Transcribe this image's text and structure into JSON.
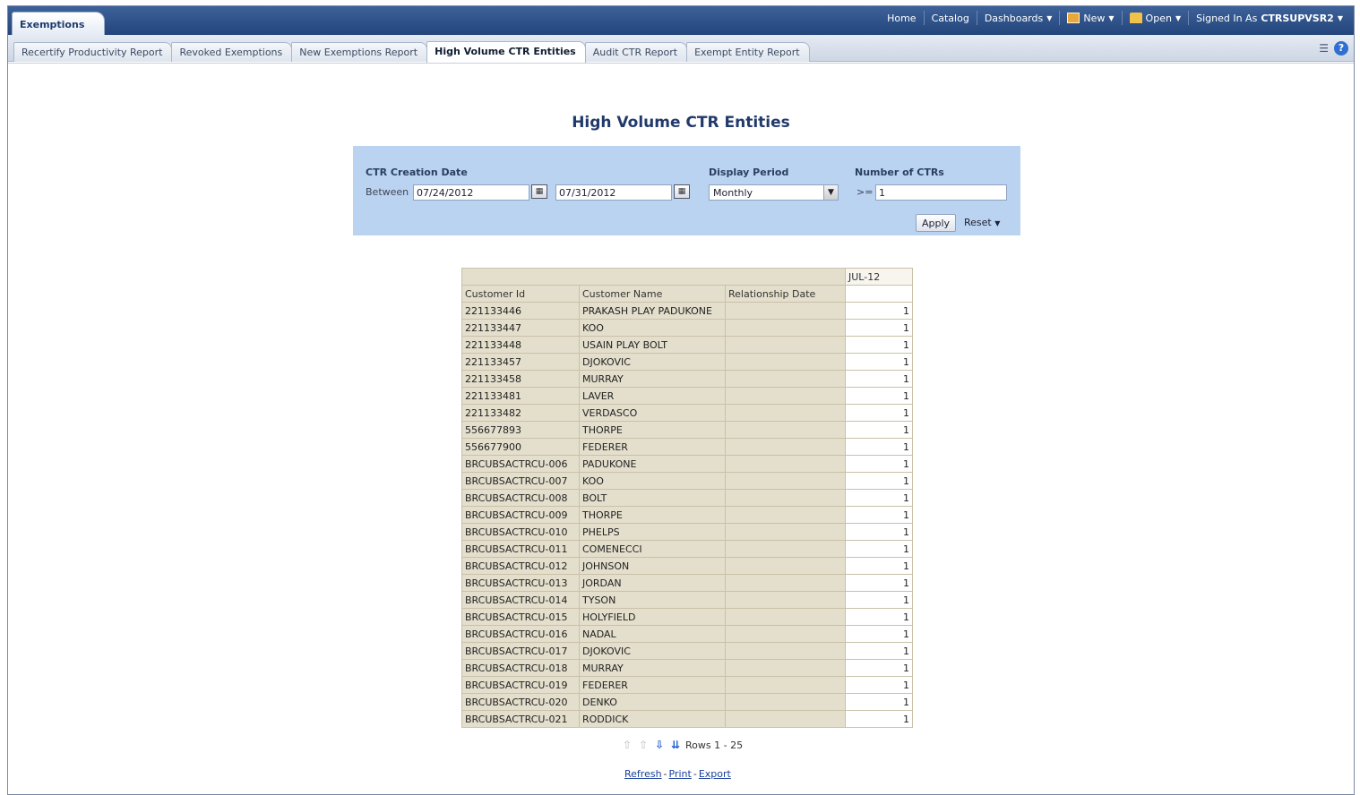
{
  "dashboard_tab": "Exemptions",
  "topnav": {
    "home": "Home",
    "catalog": "Catalog",
    "dashboards": "Dashboards",
    "new": "New",
    "open": "Open",
    "signed_in_as": "Signed In As",
    "user": "CTRSUPVSR2"
  },
  "tabs": [
    "Recertify Productivity Report",
    "Revoked Exemptions",
    "New Exemptions Report",
    "High Volume CTR Entities",
    "Audit CTR Report",
    "Exempt Entity Report"
  ],
  "active_tab_index": 3,
  "page_title": "High Volume CTR Entities",
  "prompts": {
    "ctr_creation_date_label": "CTR Creation Date",
    "between_label": "Between",
    "date_from": "07/24/2012",
    "date_to": "07/31/2012",
    "display_period_label": "Display Period",
    "display_period_value": "Monthly",
    "number_of_ctrs_label": "Number of CTRs",
    "ctr_operator": ">=",
    "ctr_value": "1",
    "apply_label": "Apply",
    "reset_label": "Reset"
  },
  "table": {
    "period_header": "JUL-12",
    "columns": [
      "Customer Id",
      "Customer Name",
      "Relationship Date"
    ],
    "rows": [
      {
        "id": "221133446",
        "name": "PRAKASH PLAY PADUKONE",
        "rel": "",
        "val": "1"
      },
      {
        "id": "221133447",
        "name": "KOO",
        "rel": "",
        "val": "1"
      },
      {
        "id": "221133448",
        "name": "USAIN PLAY BOLT",
        "rel": "",
        "val": "1"
      },
      {
        "id": "221133457",
        "name": "DJOKOVIC",
        "rel": "",
        "val": "1"
      },
      {
        "id": "221133458",
        "name": "MURRAY",
        "rel": "",
        "val": "1"
      },
      {
        "id": "221133481",
        "name": "LAVER",
        "rel": "",
        "val": "1"
      },
      {
        "id": "221133482",
        "name": "VERDASCO",
        "rel": "",
        "val": "1"
      },
      {
        "id": "556677893",
        "name": "THORPE",
        "rel": "",
        "val": "1"
      },
      {
        "id": "556677900",
        "name": "FEDERER",
        "rel": "",
        "val": "1"
      },
      {
        "id": "BRCUBSACTRCU-006",
        "name": "PADUKONE",
        "rel": "",
        "val": "1"
      },
      {
        "id": "BRCUBSACTRCU-007",
        "name": "KOO",
        "rel": "",
        "val": "1"
      },
      {
        "id": "BRCUBSACTRCU-008",
        "name": "BOLT",
        "rel": "",
        "val": "1"
      },
      {
        "id": "BRCUBSACTRCU-009",
        "name": "THORPE",
        "rel": "",
        "val": "1"
      },
      {
        "id": "BRCUBSACTRCU-010",
        "name": "PHELPS",
        "rel": "",
        "val": "1"
      },
      {
        "id": "BRCUBSACTRCU-011",
        "name": "COMENECCI",
        "rel": "",
        "val": "1"
      },
      {
        "id": "BRCUBSACTRCU-012",
        "name": "JOHNSON",
        "rel": "",
        "val": "1"
      },
      {
        "id": "BRCUBSACTRCU-013",
        "name": "JORDAN",
        "rel": "",
        "val": "1"
      },
      {
        "id": "BRCUBSACTRCU-014",
        "name": "TYSON",
        "rel": "",
        "val": "1"
      },
      {
        "id": "BRCUBSACTRCU-015",
        "name": "HOLYFIELD",
        "rel": "",
        "val": "1"
      },
      {
        "id": "BRCUBSACTRCU-016",
        "name": "NADAL",
        "rel": "",
        "val": "1"
      },
      {
        "id": "BRCUBSACTRCU-017",
        "name": "DJOKOVIC",
        "rel": "",
        "val": "1"
      },
      {
        "id": "BRCUBSACTRCU-018",
        "name": "MURRAY",
        "rel": "",
        "val": "1"
      },
      {
        "id": "BRCUBSACTRCU-019",
        "name": "FEDERER",
        "rel": "",
        "val": "1"
      },
      {
        "id": "BRCUBSACTRCU-020",
        "name": "DENKO",
        "rel": "",
        "val": "1"
      },
      {
        "id": "BRCUBSACTRCU-021",
        "name": "RODDICK",
        "rel": "",
        "val": "1"
      }
    ]
  },
  "pager": {
    "rows_text": "Rows 1 - 25",
    "icons": [
      "first-page-icon",
      "previous-page-icon",
      "next-page-icon",
      "last-page-icon"
    ]
  },
  "links": {
    "refresh": "Refresh",
    "print": "Print",
    "export": "Export",
    "separator": "-"
  },
  "colors": {
    "header_bar": "#23457c",
    "prompt_panel": "#b9d3f1",
    "table_header": "#e4dfcc",
    "title": "#223a6b"
  }
}
